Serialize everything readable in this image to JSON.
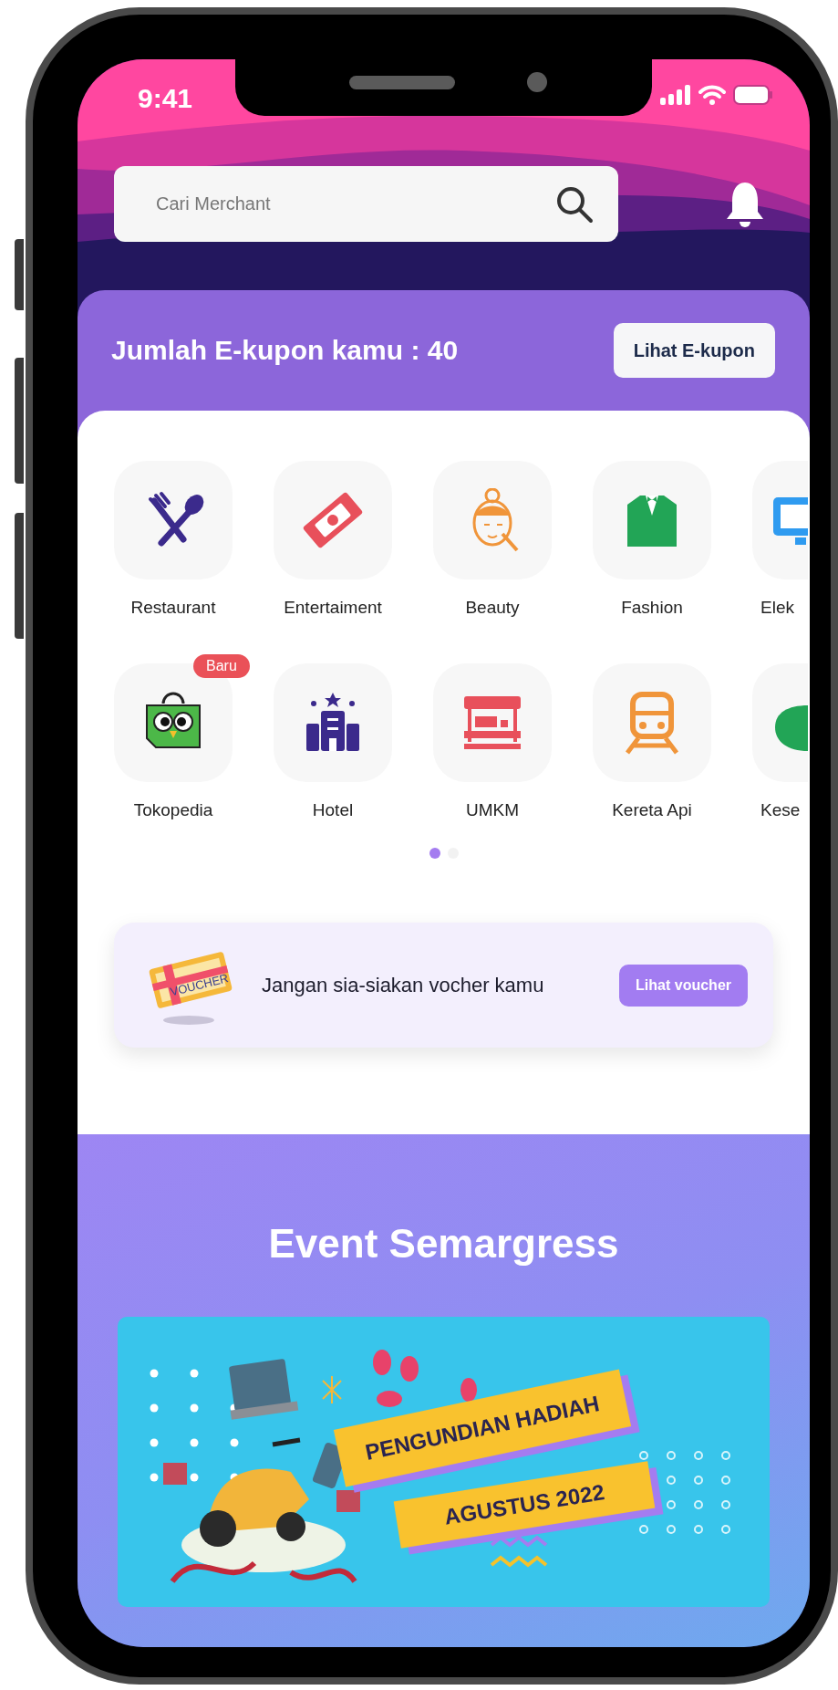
{
  "status_bar": {
    "time": "9:41"
  },
  "search": {
    "placeholder": "Cari Merchant"
  },
  "coupon": {
    "text": "Jumlah E-kupon kamu : 40",
    "button": "Lihat E-kupon"
  },
  "category_rows": [
    {
      "items": [
        {
          "label": "Restaurant"
        },
        {
          "label": "Entertaiment"
        },
        {
          "label": "Beauty"
        },
        {
          "label": "Fashion"
        },
        {
          "label": "Elek"
        }
      ]
    },
    {
      "items": [
        {
          "label": "Tokopedia",
          "badge": "Baru"
        },
        {
          "label": "Hotel"
        },
        {
          "label": "UMKM"
        },
        {
          "label": "Kereta Api"
        },
        {
          "label": "Kese"
        }
      ]
    }
  ],
  "page_dots": [
    {
      "selected": true
    },
    {
      "selected": false
    }
  ],
  "voucher_banner": {
    "image_label": "VOUCHER",
    "text": "Jangan sia-siakan vocher kamu",
    "button": "Lihat voucher"
  },
  "event": {
    "title": "Event Semargress",
    "banner_lines": [
      "PENGUNDIAN HADIAH",
      "AGUSTUS 2022"
    ]
  }
}
